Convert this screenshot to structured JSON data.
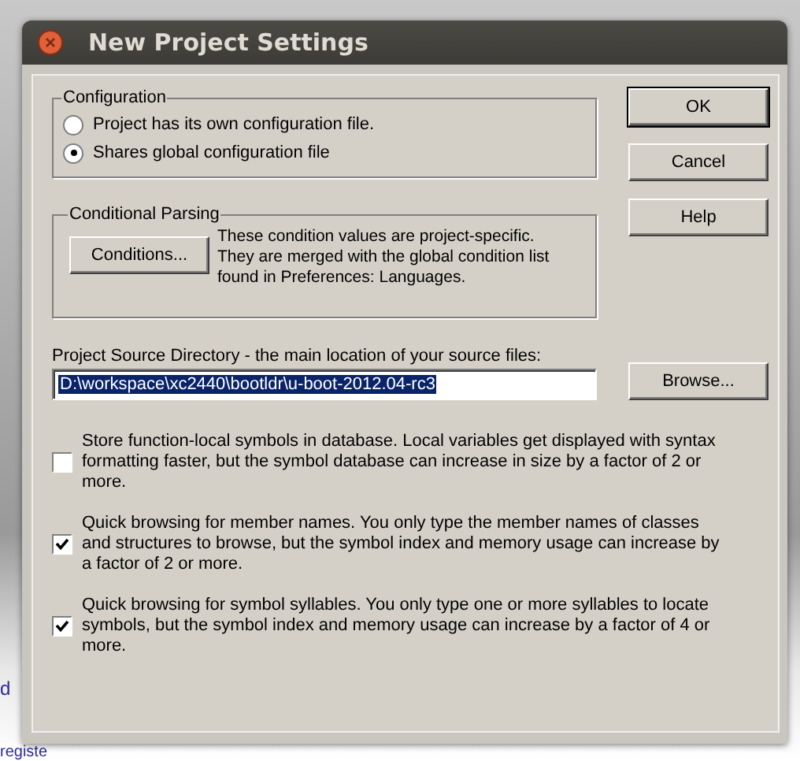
{
  "background_text": [
    "d",
    "registe"
  ],
  "window": {
    "title": "New Project Settings"
  },
  "configuration": {
    "title": "Configuration",
    "options": [
      {
        "label": "Project has its own configuration file.",
        "selected": false
      },
      {
        "label": "Shares global configuration file",
        "selected": true
      }
    ]
  },
  "conditional_parsing": {
    "title": "Conditional Parsing",
    "button": "Conditions...",
    "description": "These condition values are project-specific. They are merged with the global condition list found in Preferences: Languages."
  },
  "source_directory": {
    "label": "Project Source Directory - the main location of your source files:",
    "value": "D:\\workspace\\xc2440\\bootldr\\u-boot-2012.04-rc3",
    "selected": true
  },
  "options": [
    {
      "label": "Store function-local symbols in database.  Local variables get displayed with syntax formatting faster, but the symbol database can increase in size by a factor of 2 or more.",
      "checked": false
    },
    {
      "label": "Quick browsing for member names.  You only type the member names of classes and structures to browse, but the symbol index and memory usage can increase by a factor of 2 or more.",
      "checked": true
    },
    {
      "label": "Quick browsing for symbol syllables.  You only type one or more syllables to locate symbols, but the symbol index and memory usage can increase by a factor of 4 or more.",
      "checked": true
    }
  ],
  "buttons": {
    "ok": "OK",
    "cancel": "Cancel",
    "help": "Help",
    "browse": "Browse..."
  }
}
